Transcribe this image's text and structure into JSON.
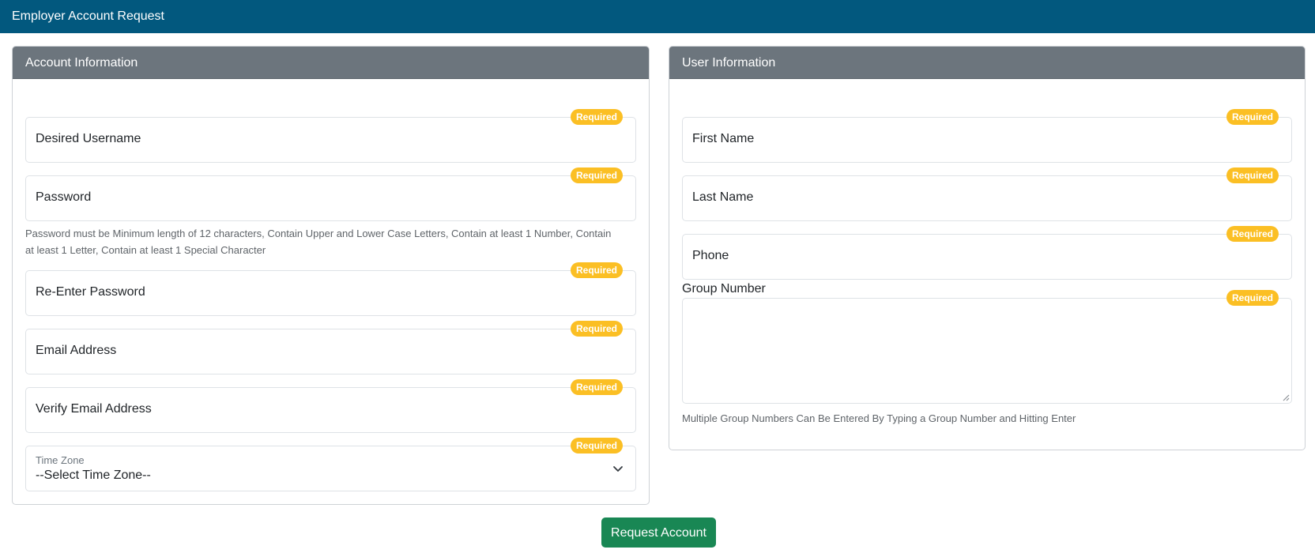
{
  "page": {
    "title": "Employer Account Request"
  },
  "account": {
    "header": "Account Information",
    "required_badge": "Required",
    "username_label": "Desired Username",
    "password_label": "Password",
    "password_help": "Password must be Minimum length of 12 characters, Contain Upper and Lower Case Letters, Contain at least 1 Number, Contain at least 1 Letter, Contain at least 1 Special Character",
    "reenter_password_label": "Re-Enter Password",
    "email_label": "Email Address",
    "verify_email_label": "Verify Email Address",
    "timezone_label": "Time Zone",
    "timezone_value": "--Select Time Zone--"
  },
  "user": {
    "header": "User Information",
    "required_badge": "Required",
    "first_name_label": "First Name",
    "last_name_label": "Last Name",
    "phone_label": "Phone",
    "group_number_label": "Group Number",
    "group_help": "Multiple Group Numbers Can Be Entered By Typing a Group Number and Hitting Enter"
  },
  "actions": {
    "submit_label": "Request Account"
  },
  "colors": {
    "topbar": "#02587e",
    "card_header": "#6c757d",
    "badge": "#fbbf24",
    "submit": "#198754"
  },
  "icons": {
    "select_toggle": "chevron-down-icon",
    "textarea_resize": "resize-grip-icon"
  }
}
